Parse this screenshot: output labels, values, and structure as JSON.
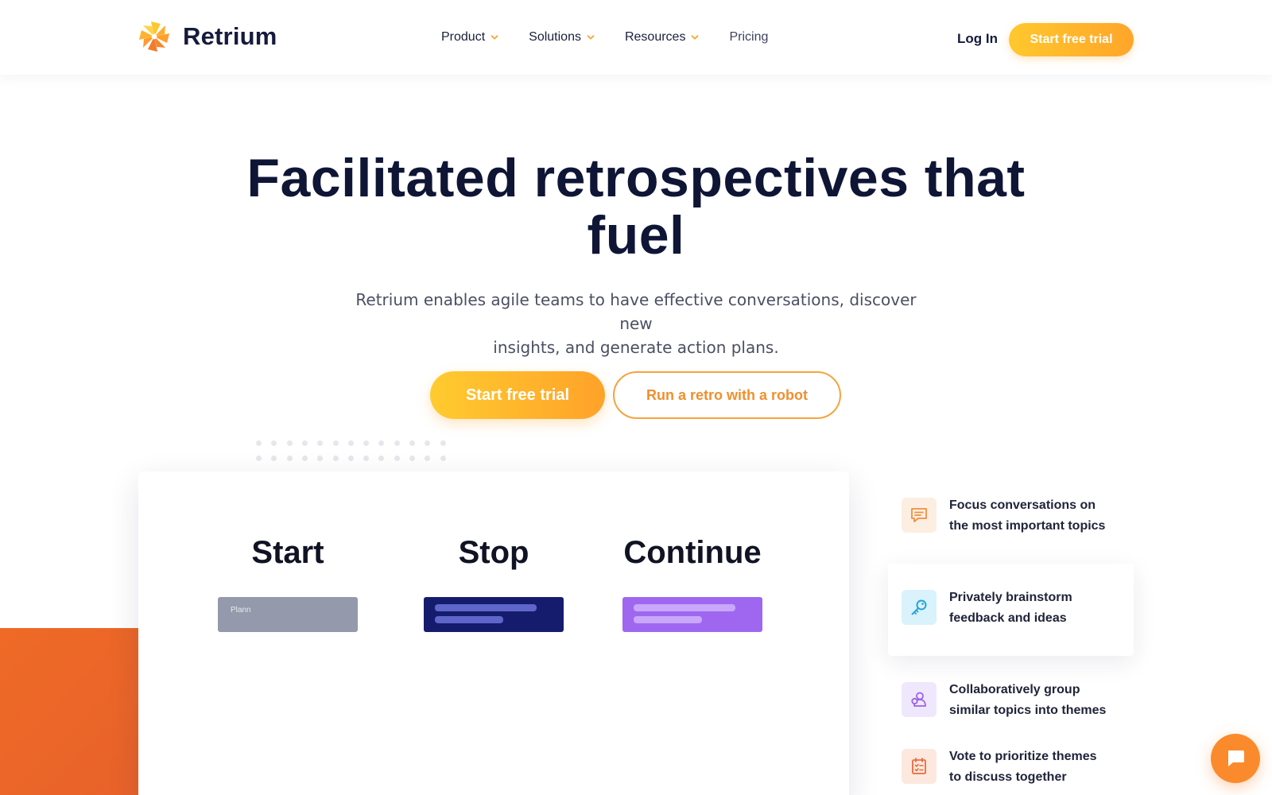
{
  "brand": {
    "name": "Retrium",
    "logo_icon": "pinwheel-logo-icon",
    "accent_orange": "#ffa52a",
    "accent_yellow": "#ffc82d",
    "navy_text": "#0f1535"
  },
  "nav": {
    "items": [
      {
        "label": "Product",
        "has_dropdown": true
      },
      {
        "label": "Solutions",
        "has_dropdown": true
      },
      {
        "label": "Resources",
        "has_dropdown": true
      },
      {
        "label": "Pricing",
        "has_dropdown": false
      }
    ],
    "login_label": "Log In",
    "cta_label": "Start free trial"
  },
  "hero": {
    "title_line1": "Facilitated retrospectives that",
    "title_line2": "fuel",
    "subtitle_line1": "Retrium enables agile teams to have effective conversations, discover new",
    "subtitle_line2": "insights, and generate action plans.",
    "primary_cta": "Start free trial",
    "secondary_cta": "Run a retro with a robot"
  },
  "board": {
    "columns": [
      {
        "title": "Start",
        "card_color": "#9499ab",
        "card_text": "Plann"
      },
      {
        "title": "Stop",
        "card_color": "#161c6d"
      },
      {
        "title": "Continue",
        "card_color": "#9f67f0"
      }
    ]
  },
  "features": [
    {
      "icon": "chat-icon",
      "line1": "Focus conversations on",
      "line2": "the most important topics",
      "bg": "#fdeee2",
      "color": "#f08f3e"
    },
    {
      "icon": "key-icon",
      "line1": "Privately brainstorm",
      "line2": "feedback and ideas",
      "bg": "#d9f2fb",
      "color": "#1ea0d6"
    },
    {
      "icon": "group-icon",
      "line1": "Collaboratively group",
      "line2": "similar topics into themes",
      "bg": "#efe7fb",
      "color": "#9a62e6"
    },
    {
      "icon": "checklist-icon",
      "line1": "Vote to prioritize themes",
      "line2": "to discuss together",
      "bg": "#fde8df",
      "color": "#ec6a3a"
    }
  ],
  "chat": {
    "icon": "chat-bubble-icon"
  }
}
